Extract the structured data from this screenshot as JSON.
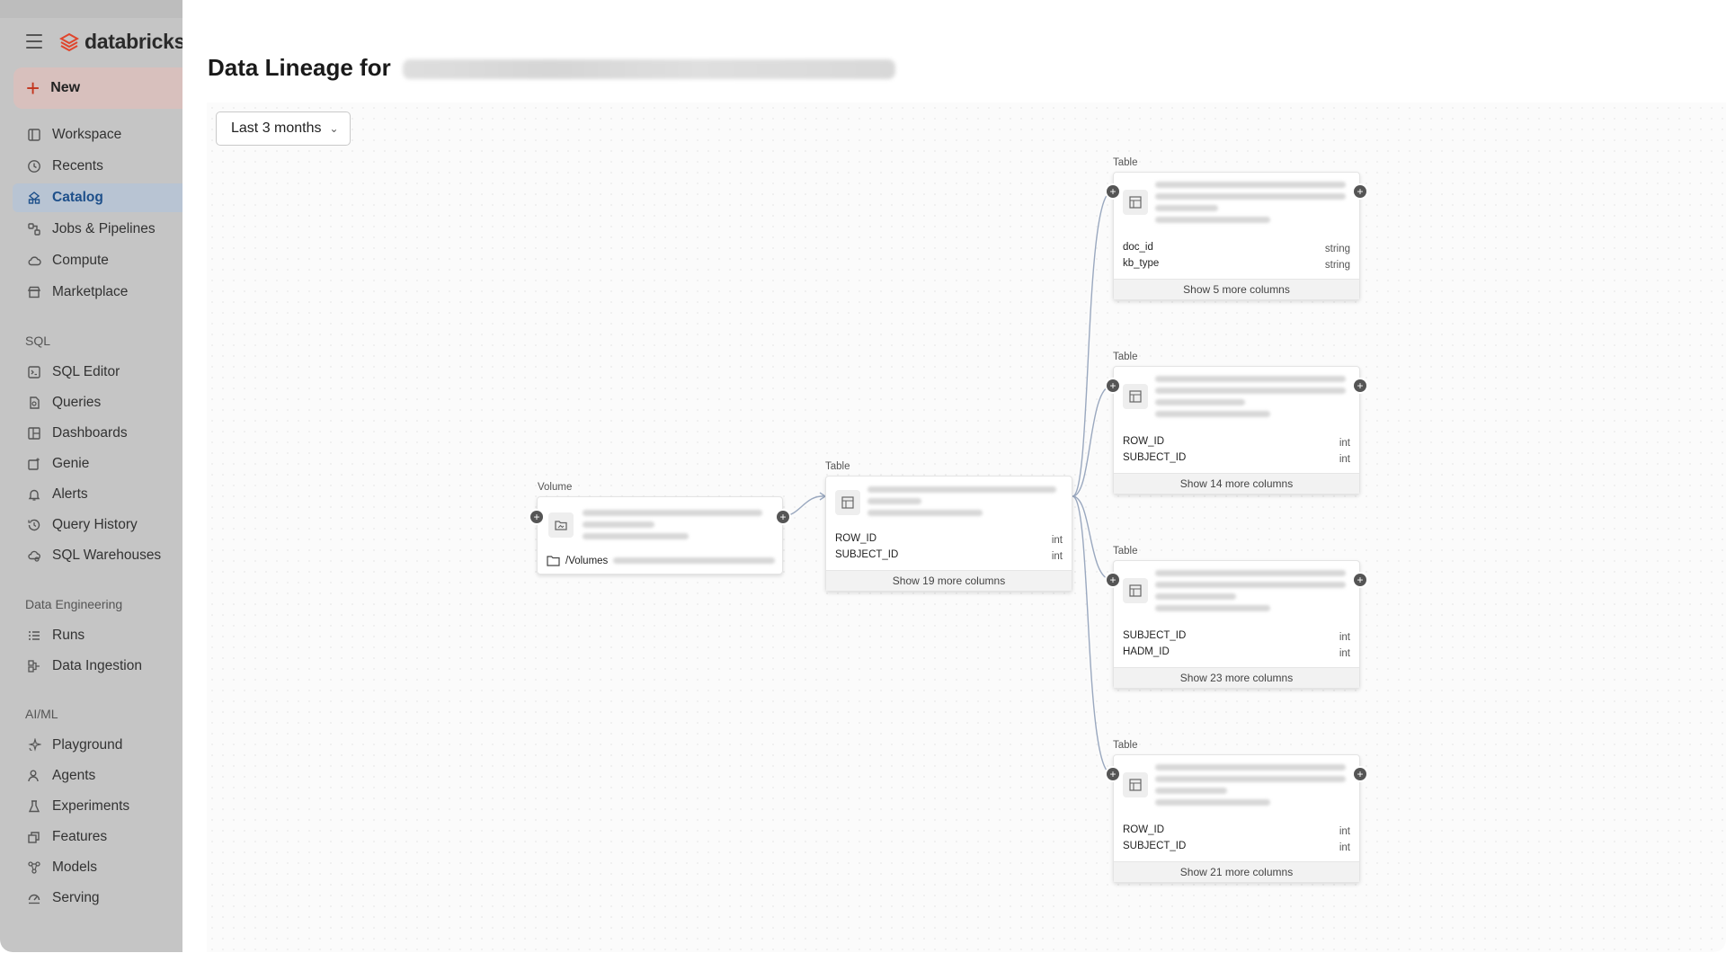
{
  "app": {
    "brand": "databricks"
  },
  "sidebar": {
    "new_label": "New",
    "main_items": [
      {
        "label": "Workspace",
        "icon": "workspace-icon"
      },
      {
        "label": "Recents",
        "icon": "clock-icon"
      },
      {
        "label": "Catalog",
        "icon": "catalog-icon",
        "active": true
      },
      {
        "label": "Jobs & Pipelines",
        "icon": "jobs-icon"
      },
      {
        "label": "Compute",
        "icon": "cloud-icon"
      },
      {
        "label": "Marketplace",
        "icon": "store-icon"
      }
    ],
    "sql_label": "SQL",
    "sql_items": [
      {
        "label": "SQL Editor",
        "icon": "sql-editor-icon"
      },
      {
        "label": "Queries",
        "icon": "query-icon"
      },
      {
        "label": "Dashboards",
        "icon": "dashboard-icon"
      },
      {
        "label": "Genie",
        "icon": "genie-icon"
      },
      {
        "label": "Alerts",
        "icon": "bell-icon"
      },
      {
        "label": "Query History",
        "icon": "history-icon"
      },
      {
        "label": "SQL Warehouses",
        "icon": "warehouse-icon"
      }
    ],
    "de_label": "Data Engineering",
    "de_items": [
      {
        "label": "Runs",
        "icon": "runs-icon"
      },
      {
        "label": "Data Ingestion",
        "icon": "ingestion-icon"
      }
    ],
    "ai_label": "AI/ML",
    "ai_items": [
      {
        "label": "Playground",
        "icon": "sparkle-icon"
      },
      {
        "label": "Agents",
        "icon": "agent-icon"
      },
      {
        "label": "Experiments",
        "icon": "flask-icon"
      },
      {
        "label": "Features",
        "icon": "features-icon"
      },
      {
        "label": "Models",
        "icon": "models-icon"
      },
      {
        "label": "Serving",
        "icon": "serving-icon"
      }
    ]
  },
  "page": {
    "title": "Data Lineage for",
    "range_filter": "Last 3 months"
  },
  "lineage": {
    "volume": {
      "type_label": "Volume",
      "path_prefix": "/Volumes"
    },
    "source_table": {
      "type_label": "Table",
      "columns": [
        {
          "name": "ROW_ID",
          "type": "int"
        },
        {
          "name": "SUBJECT_ID",
          "type": "int"
        }
      ],
      "more": "Show 19 more columns"
    },
    "downstream": [
      {
        "type_label": "Table",
        "columns": [
          {
            "name": "doc_id",
            "type": "string"
          },
          {
            "name": "kb_type",
            "type": "string"
          }
        ],
        "more": "Show 5 more columns"
      },
      {
        "type_label": "Table",
        "columns": [
          {
            "name": "ROW_ID",
            "type": "int"
          },
          {
            "name": "SUBJECT_ID",
            "type": "int"
          }
        ],
        "more": "Show 14 more columns"
      },
      {
        "type_label": "Table",
        "columns": [
          {
            "name": "SUBJECT_ID",
            "type": "int"
          },
          {
            "name": "HADM_ID",
            "type": "int"
          }
        ],
        "more": "Show 23 more columns"
      },
      {
        "type_label": "Table",
        "columns": [
          {
            "name": "ROW_ID",
            "type": "int"
          },
          {
            "name": "SUBJECT_ID",
            "type": "int"
          }
        ],
        "more": "Show 21 more columns"
      }
    ]
  }
}
